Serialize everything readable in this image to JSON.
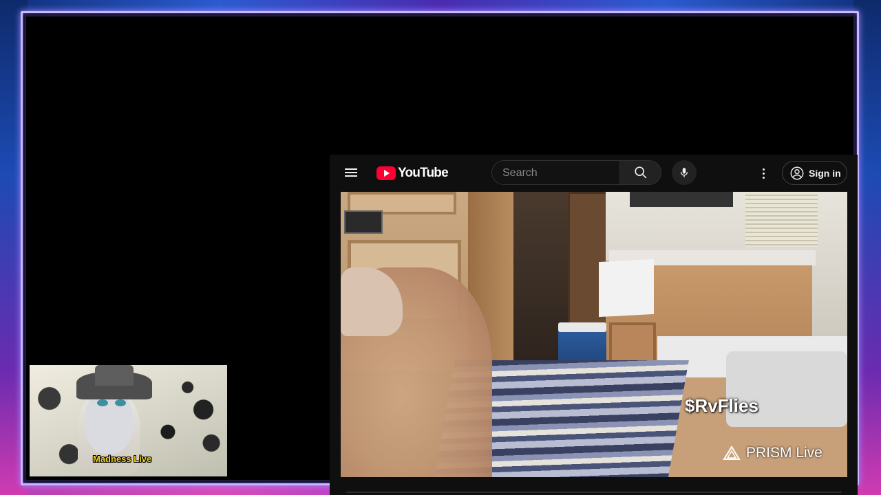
{
  "youtube": {
    "logo_text": "YouTube",
    "search": {
      "placeholder": "Search",
      "value": ""
    },
    "signin_label": "Sign in"
  },
  "video_overlay": {
    "tag": "$RvFlies",
    "watermark": "PRISM Live"
  },
  "webcam": {
    "label": "Madness Live"
  },
  "colors": {
    "frame_border": "#c9b8ff",
    "youtube_red": "#ff0033",
    "label_yellow": "#f7d21c"
  },
  "icons": [
    "menu-icon",
    "youtube-logo-icon",
    "search-icon",
    "mic-icon",
    "more-vert-icon",
    "account-icon",
    "prism-triangle-icon"
  ]
}
